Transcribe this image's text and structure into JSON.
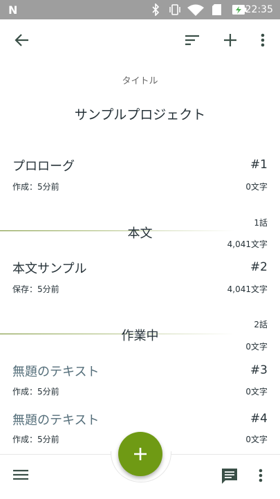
{
  "status_bar": {
    "time": "22:35",
    "carrier_icon": "N"
  },
  "toolbar": {
    "back_icon": "arrow-left-icon",
    "sort_icon": "sort-icon",
    "add_icon": "plus-icon",
    "menu_icon": "more-vert-icon"
  },
  "header": {
    "label": "タイトル",
    "project_title": "サンプルプロジェクト"
  },
  "items": [
    {
      "title": "プロローグ",
      "number": "#1",
      "meta": "作成：5分前",
      "chars": "0文字"
    },
    {
      "title": "本文サンプル",
      "number": "#2",
      "meta": "保存：5分前",
      "chars": "4,041文字"
    },
    {
      "title": "無題のテキスト",
      "number": "#3",
      "meta": "作成：5分前",
      "chars": "0文字"
    },
    {
      "title": "無題のテキスト",
      "number": "#4",
      "meta": "作成：5分前",
      "chars": "0文字"
    }
  ],
  "chapters": [
    {
      "name": "本文",
      "episodes": "1話",
      "chars": "4,041文字"
    },
    {
      "name": "作業中",
      "episodes": "2話",
      "chars": "0文字"
    }
  ],
  "bottom_bar": {
    "menu_icon": "hamburger-icon",
    "fab_icon": "plus-icon",
    "chat_icon": "comment-icon",
    "more_icon": "more-vert-icon"
  },
  "colors": {
    "accent": "#6f9a14",
    "icon": "#3a4f47",
    "status_bar": "#9e9e9e"
  }
}
